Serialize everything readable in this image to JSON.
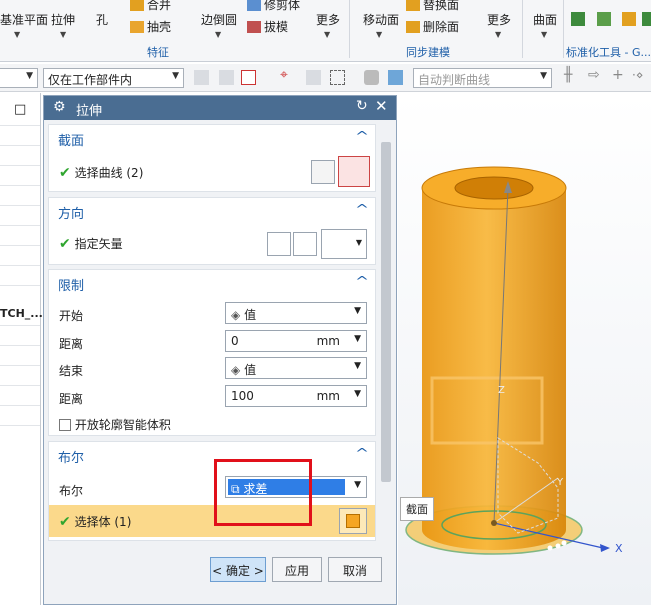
{
  "ribbon": {
    "buttons": [
      {
        "id": "plane",
        "label": "基准平面"
      },
      {
        "id": "extrude",
        "label": "拉伸"
      },
      {
        "id": "hole",
        "label": "孔"
      },
      {
        "id": "unite",
        "label": "合并"
      },
      {
        "id": "shell",
        "label": "抽壳"
      },
      {
        "id": "edge_blend",
        "label": "边倒圆"
      },
      {
        "id": "trim_body",
        "label": "修剪体"
      },
      {
        "id": "draft",
        "label": "拔模"
      },
      {
        "id": "more1",
        "label": "更多"
      },
      {
        "id": "move_face",
        "label": "移动面"
      },
      {
        "id": "replace_face",
        "label": "替换面"
      },
      {
        "id": "delete_face",
        "label": "删除面"
      },
      {
        "id": "more2",
        "label": "更多"
      },
      {
        "id": "surface",
        "label": "曲面"
      }
    ],
    "groups": {
      "feature": "特征",
      "sync": "同步建模",
      "standard": "标准化工具 - G..."
    }
  },
  "toolbar": {
    "filter_value": "",
    "scope_value": "仅在工作部件内",
    "snap_value": "自动判断曲线"
  },
  "left_panel": {
    "close_glyph": "□",
    "item_label": "TCH_..."
  },
  "dialog": {
    "title": "拉伸",
    "section_profile": {
      "header": "截面",
      "select_curve": "选择曲线 (2)"
    },
    "section_direction": {
      "header": "方向",
      "specify_vector": "指定矢量"
    },
    "section_limits": {
      "header": "限制",
      "start_label": "开始",
      "start_option": "值",
      "start_distance_label": "距离",
      "start_distance_value": "0",
      "start_unit": "mm",
      "end_label": "结束",
      "end_option": "值",
      "end_distance_label": "距离",
      "end_distance_value": "100",
      "end_unit": "mm",
      "open_profile": "开放轮廓智能体积"
    },
    "section_boolean": {
      "header": "布尔",
      "boolean_label": "布尔",
      "boolean_value": "求差",
      "select_body": "选择体 (1)"
    },
    "ok": "< 确定 >",
    "apply": "应用",
    "cancel": "取消"
  },
  "viewport": {
    "tooltip": "截面",
    "axis_x": "X",
    "axis_y": "Y",
    "axis_z": "Z",
    "body_color": "#f5a623"
  }
}
